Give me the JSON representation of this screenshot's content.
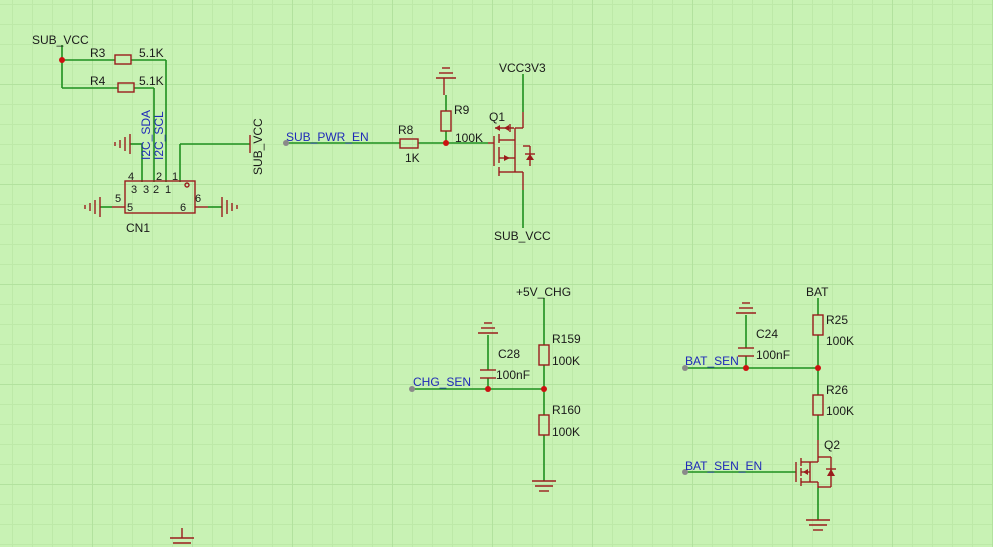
{
  "colors": {
    "background": "#c8f2b4",
    "wire": "#1e8f1e",
    "component": "#9a1c1c",
    "net_label": "#1f2ab8",
    "junction": "#cc1111"
  },
  "nets": {
    "sub_vcc_top": "SUB_VCC",
    "sub_vcc_rot": "SUB_VCC",
    "sub_pwr_en": "SUB_PWR_EN",
    "vcc3v3": "VCC3V3",
    "sub_vcc_bottom": "SUB_VCC",
    "plus5v_chg": "+5V_CHG",
    "chg_sen": "CHG_SEN",
    "bat": "BAT",
    "bat_sen": "BAT_SEN",
    "bat_sen_en": "BAT_SEN_EN"
  },
  "components": {
    "r3": {
      "ref": "R3",
      "value": "5.1K"
    },
    "r4": {
      "ref": "R4",
      "value": "5.1K"
    },
    "cn1": {
      "ref": "CN1",
      "pins": [
        "4",
        "3",
        "2",
        "1",
        "5",
        "6"
      ],
      "pin_names": {
        "sda": "I2C_SDA",
        "scl": "I2C_SCL"
      }
    },
    "r8": {
      "ref": "R8",
      "value": "1K"
    },
    "r9": {
      "ref": "R9",
      "value": "100K"
    },
    "q1": {
      "ref": "Q1"
    },
    "c28": {
      "ref": "C28",
      "value": "100nF"
    },
    "r159": {
      "ref": "R159",
      "value": "100K"
    },
    "r160": {
      "ref": "R160",
      "value": "100K"
    },
    "c24": {
      "ref": "C24",
      "value": "100nF"
    },
    "r25": {
      "ref": "R25",
      "value": "100K"
    },
    "r26": {
      "ref": "R26",
      "value": "100K"
    },
    "q2": {
      "ref": "Q2"
    }
  }
}
